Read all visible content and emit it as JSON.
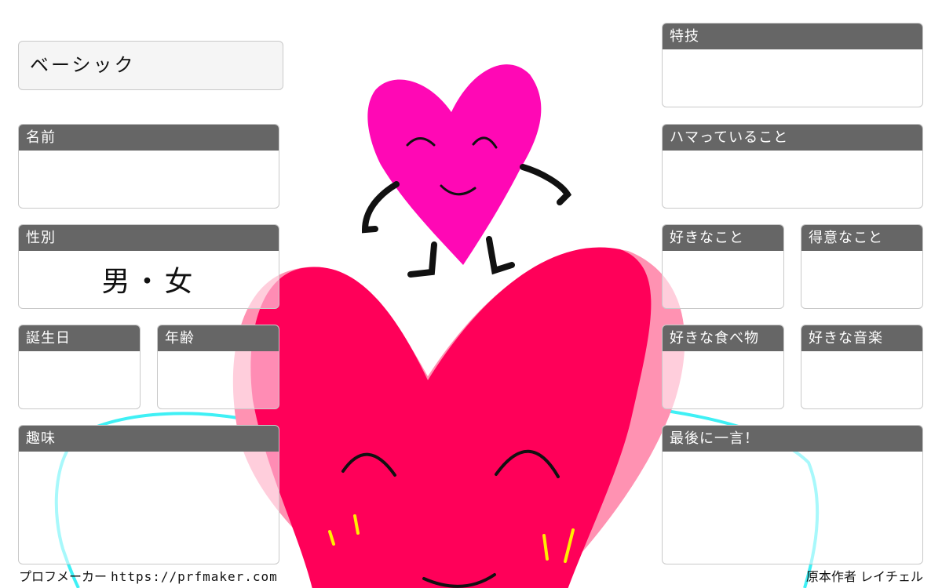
{
  "title_card": {
    "label": "ベーシック"
  },
  "fields": {
    "name": "名前",
    "gender": "性別",
    "gender_value": "男・女",
    "birthday": "誕生日",
    "age": "年齢",
    "hobby": "趣味",
    "skill": "特技",
    "into_now": "ハマっていること",
    "likes": "好きなこと",
    "good_at": "得意なこと",
    "favorite_food": "好きな食べ物",
    "favorite_music": "好きな音楽",
    "last_word": "最後に一言！"
  },
  "footer": {
    "brand": "プロフメーカー",
    "url": "https://prfmaker.com",
    "author": "原本作者 レイチェル"
  },
  "colors": {
    "header_bg": "#666666",
    "big_heart": "#ff0059",
    "small_heart": "#ff08b5",
    "wings": "#3ff0f5",
    "cheeks": "#ffee00"
  }
}
